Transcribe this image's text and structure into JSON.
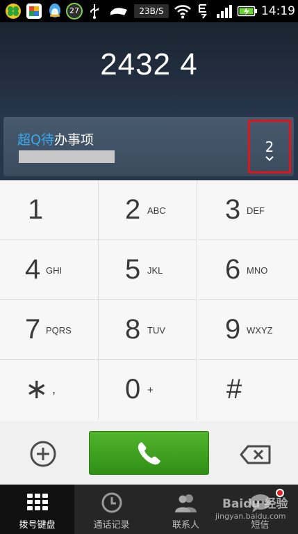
{
  "status_bar": {
    "battery_badge": "27",
    "net_speed": "23B/S",
    "time": "14:19"
  },
  "dialer": {
    "number": "2432 4"
  },
  "suggestion": {
    "name_highlight": "超Q待",
    "name_rest": "办事项",
    "match_count": "2"
  },
  "keys": [
    {
      "digit": "1",
      "letters": ""
    },
    {
      "digit": "2",
      "letters": "ABC"
    },
    {
      "digit": "3",
      "letters": "DEF"
    },
    {
      "digit": "4",
      "letters": "GHI"
    },
    {
      "digit": "5",
      "letters": "JKL"
    },
    {
      "digit": "6",
      "letters": "MNO"
    },
    {
      "digit": "7",
      "letters": "PQRS"
    },
    {
      "digit": "8",
      "letters": "TUV"
    },
    {
      "digit": "9",
      "letters": "WXYZ"
    },
    {
      "digit": "∗",
      "letters": ","
    },
    {
      "digit": "0",
      "letters": "+"
    },
    {
      "digit": "#",
      "letters": ""
    }
  ],
  "nav": {
    "tabs": [
      {
        "label": "拨号键盘",
        "icon": "keypad-icon"
      },
      {
        "label": "通话记录",
        "icon": "clock-icon"
      },
      {
        "label": "联系人",
        "icon": "contacts-icon"
      },
      {
        "label": "短信",
        "icon": "message-icon"
      }
    ]
  },
  "watermark": {
    "line1": "Baidu 经验",
    "line2": "jingyan.baidu.com"
  },
  "colors": {
    "call_green": "#3aa31d",
    "highlight_blue": "#39a9f0",
    "annotation_red": "#e0151a"
  }
}
